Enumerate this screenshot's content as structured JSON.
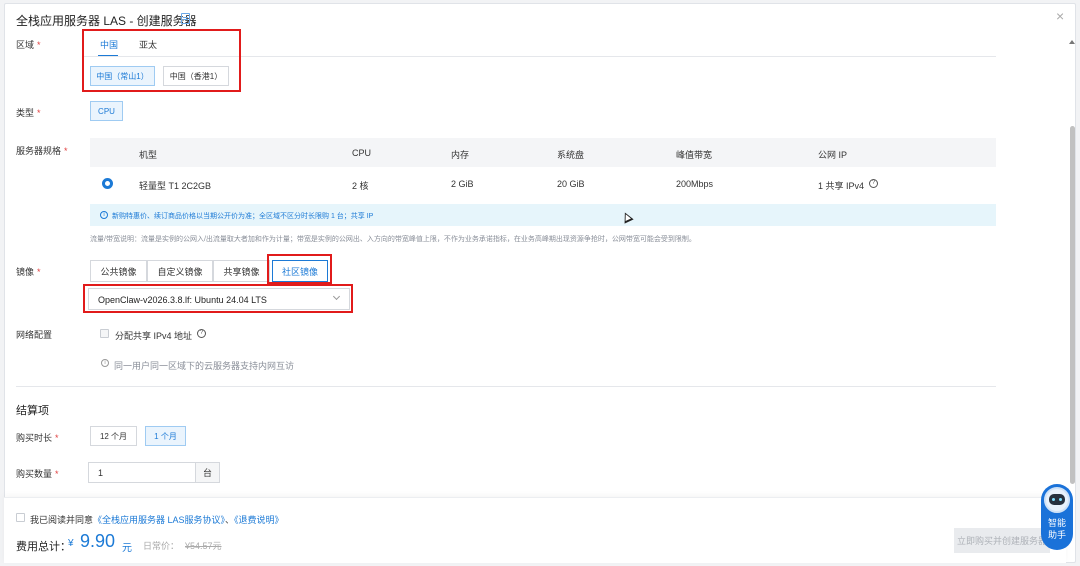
{
  "dialog": {
    "title": "全栈应用服务器 LAS - 创建服务器",
    "close_label": "×"
  },
  "region": {
    "label": "区域",
    "required": "*",
    "tabs": [
      "中国",
      "亚太"
    ],
    "options": [
      "中国（常山1）",
      "中国（香港1）"
    ]
  },
  "type": {
    "label": "类型",
    "required": "*",
    "value": "CPU"
  },
  "spec": {
    "label": "服务器规格",
    "required": "*",
    "headers": [
      "机型",
      "CPU",
      "内存",
      "系统盘",
      "峰值带宽",
      "公网 IP"
    ],
    "row": [
      "轻量型 T1 2C2GB",
      "2 核",
      "2 GiB",
      "20 GiB",
      "200Mbps",
      "1 共享 IPv4"
    ],
    "info": "新购特惠价、续订商品价格以当期公开价为准；全区域不区分时长限购 1 台；共享 IP",
    "note": "流量/带宽说明：流量是实例的公网入/出流量取大者加和作为计量；带宽是实例的公网出、入方向的带宽峰值上限，不作为业务承诺指标，在业务高峰期出现资源争抢时，公网带宽可能会受到限制。"
  },
  "image": {
    "label": "镜像",
    "required": "*",
    "tabs": [
      "公共镜像",
      "自定义镜像",
      "共享镜像",
      "社区镜像"
    ],
    "selected": "OpenClaw-v2026.3.8.lf: Ubuntu 24.04 LTS"
  },
  "network": {
    "label": "网络配置",
    "checkbox_label": "分配共享 IPv4 地址",
    "hint": "同一用户同一区域下的云服务器支持内网互访"
  },
  "billing": {
    "section_title": "结算项",
    "duration_label": "购买时长",
    "duration_options": [
      "12 个月",
      "1 个月"
    ],
    "quantity_label": "购买数量",
    "quantity_value": "1",
    "quantity_unit": "台",
    "required": "*"
  },
  "footer": {
    "agree_prefix": "我已阅读并同意",
    "agreement_link": "《全栈应用服务器 LAS服务协议》",
    "separator": "、",
    "refund_link": "《退费说明》",
    "total_label": "费用总计：",
    "currency": "¥",
    "total_value": "9.90",
    "total_unit": "元",
    "original_label": "日常价：",
    "original_value": "¥54.57元",
    "buy_button": "立即购买并创建服务器"
  },
  "assistant": {
    "line1": "智能",
    "line2": "助手"
  },
  "colors": {
    "accent": "#1c7ad6",
    "annotation": "#e11b1b"
  }
}
